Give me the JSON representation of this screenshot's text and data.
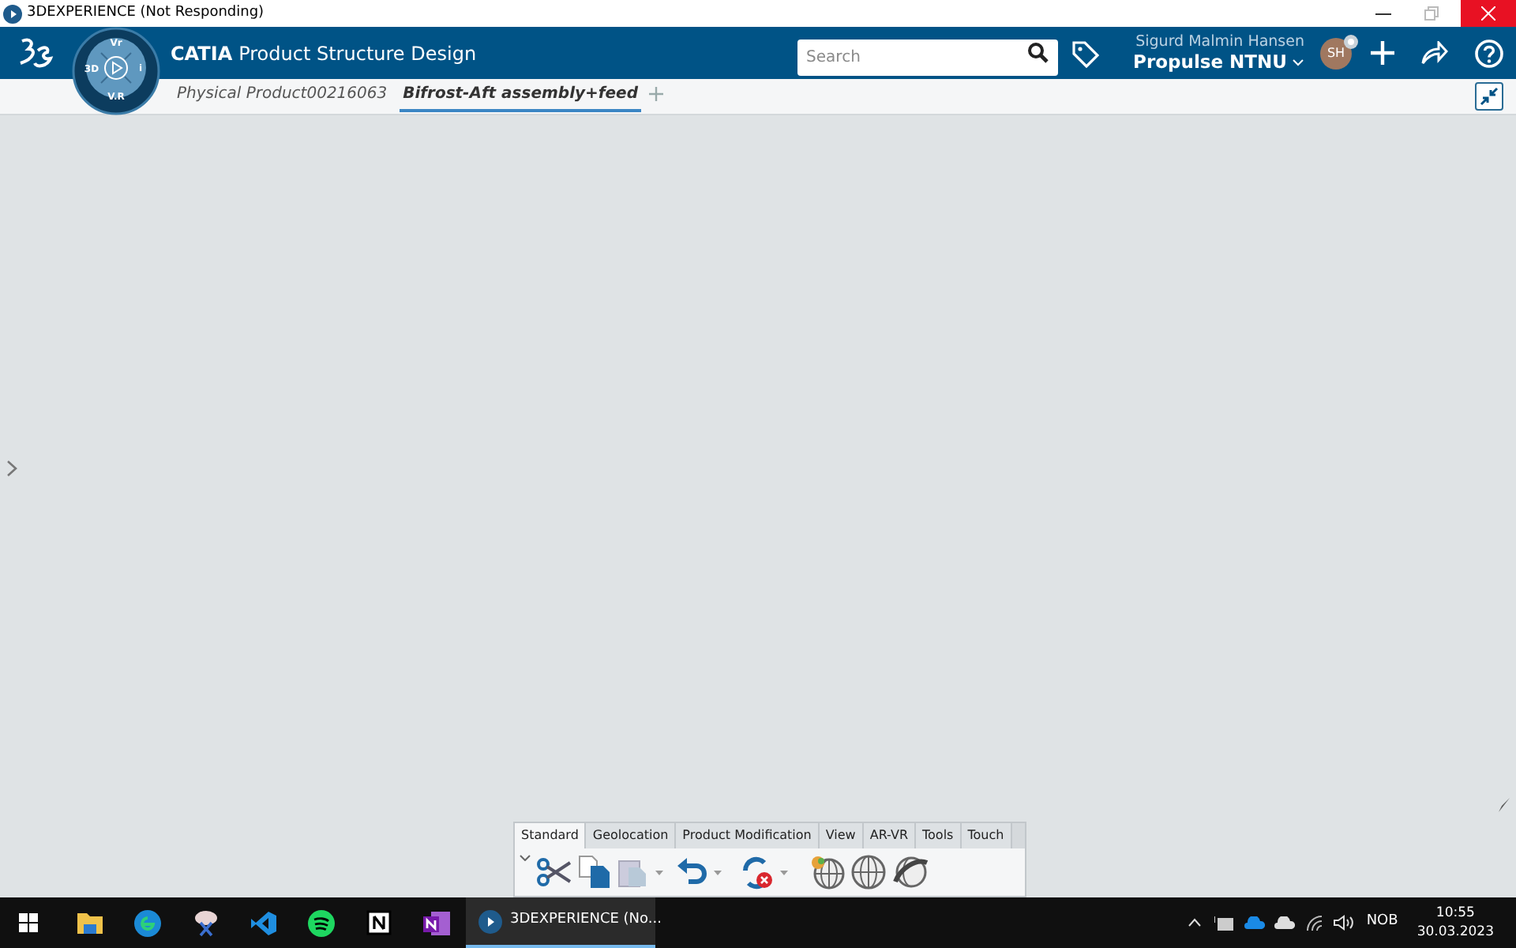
{
  "window": {
    "title": "3DEXPERIENCE (Not Responding)"
  },
  "compass": {
    "top": "Vr",
    "left": "3D",
    "right": "i",
    "bottom": "V.R"
  },
  "app": {
    "brand": "CATIA",
    "title": "Product Structure Design"
  },
  "search": {
    "placeholder": "Search"
  },
  "user": {
    "name": "Sigurd Malmin Hansen",
    "org": "Propulse NTNU",
    "initials": "SH"
  },
  "doc_tabs": [
    {
      "label": "Physical Product00216063",
      "selected": false
    },
    {
      "label": "Bifrost-Aft assembly+feed",
      "selected": true
    }
  ],
  "toolbar_tabs": [
    {
      "label": "Standard",
      "selected": true
    },
    {
      "label": "Geolocation",
      "selected": false
    },
    {
      "label": "Product Modification",
      "selected": false
    },
    {
      "label": "View",
      "selected": false
    },
    {
      "label": "AR-VR",
      "selected": false
    },
    {
      "label": "Tools",
      "selected": false
    },
    {
      "label": "Touch",
      "selected": false
    }
  ],
  "taskbar": {
    "active_app": "3DEXPERIENCE (No...",
    "language": "NOB",
    "time": "10:55",
    "date": "30.03.2023"
  }
}
